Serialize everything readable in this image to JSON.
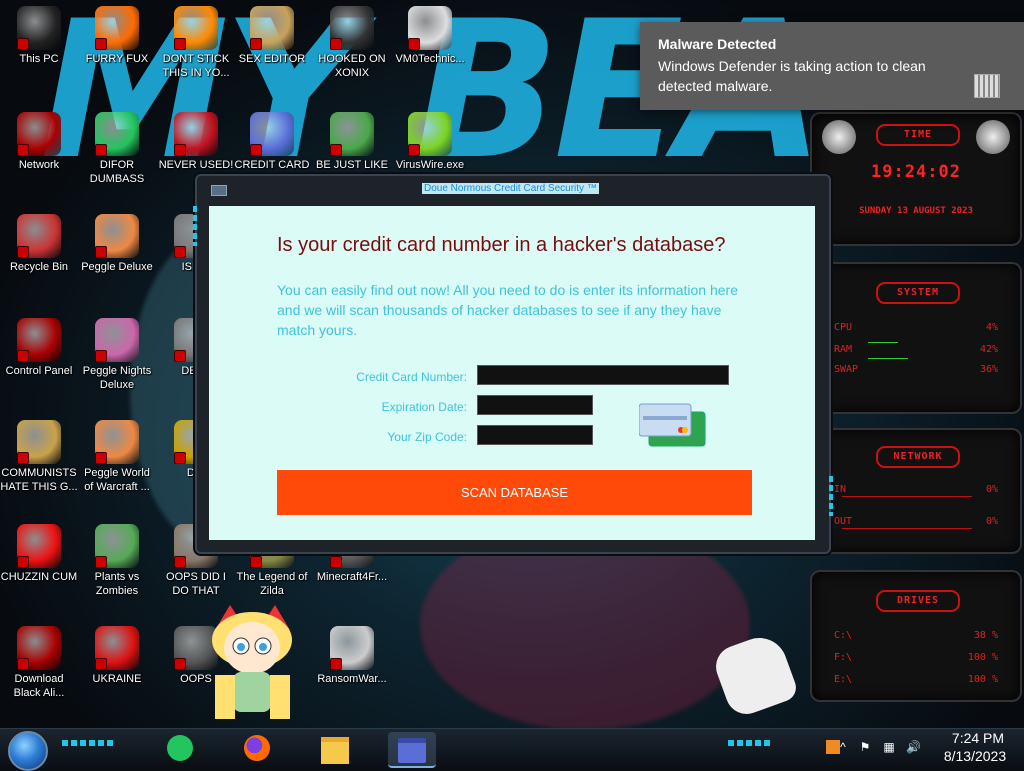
{
  "desktop": {
    "icons": [
      {
        "label": "This PC",
        "icon": "monitor-icon",
        "color": "#222"
      },
      {
        "label": "FURRY FUX",
        "icon": "firefox-icon",
        "color": "#ff6a00"
      },
      {
        "label": "DONT STICK THIS IN YO...",
        "icon": "traffic-cone-icon",
        "color": "#ff8800"
      },
      {
        "label": "SEX EDITOR",
        "icon": "image-editor-icon",
        "color": "#c9a25a"
      },
      {
        "label": "HOOKED ON XONIX",
        "icon": "game-icon",
        "color": "#333"
      },
      {
        "label": "VM0Technic...",
        "icon": "doctor-icon",
        "color": "#ddd"
      },
      {
        "label": "Network",
        "icon": "alien-network-icon",
        "color": "#a00"
      },
      {
        "label": "DIFOR DUMBASS",
        "icon": "chat-icon",
        "color": "#22c55e"
      },
      {
        "label": "NEVER USED!",
        "icon": "dev-icon",
        "color": "#c1121f"
      },
      {
        "label": "CREDIT CARD",
        "icon": "credit-card-icon",
        "color": "#5b6ed8"
      },
      {
        "label": "BE JUST LIKE",
        "icon": "santa-icon",
        "color": "#4aa84a"
      },
      {
        "label": "VirusWire.exe",
        "icon": "lime-icon",
        "color": "#7cd320"
      },
      {
        "label": "Recycle Bin",
        "icon": "recycle-bin-icon",
        "color": "#c33"
      },
      {
        "label": "Peggle Deluxe",
        "icon": "peggle-icon",
        "color": "#e84"
      },
      {
        "label": "ISRAI",
        "icon": "app-icon",
        "color": "#777"
      },
      {
        "label": "Control Panel",
        "icon": "control-panel-icon",
        "color": "#a00"
      },
      {
        "label": "Peggle Nights Deluxe",
        "icon": "peggle-icon",
        "color": "#c6a"
      },
      {
        "label": "DEEZ",
        "icon": "app-icon",
        "color": "#777"
      },
      {
        "label": "COMMUNISTS HATE THIS G...",
        "icon": "money-bag-icon",
        "color": "#c9a24a"
      },
      {
        "label": "Peggle World of Warcraft ...",
        "icon": "peggle-icon",
        "color": "#e84"
      },
      {
        "label": "DIE",
        "icon": "app-icon",
        "color": "#c9a200"
      },
      {
        "label": "CHUZZIN CUM",
        "icon": "chuzzle-icon",
        "color": "#e11"
      },
      {
        "label": "Plants vs Zombies",
        "icon": "plant-icon",
        "color": "#5a5"
      },
      {
        "label": "OOPS DID I DO THAT",
        "icon": "photo-icon",
        "color": "#876"
      },
      {
        "label": "The Legend of Zilda",
        "icon": "game-icon",
        "color": "#884"
      },
      {
        "label": "Minecraft4Fr...",
        "icon": "game-icon",
        "color": "#555"
      },
      {
        "label": "Download Black Ali...",
        "icon": "alien-icon",
        "color": "#a00"
      },
      {
        "label": "UKRAINE",
        "icon": "radiation-icon",
        "color": "#d11"
      },
      {
        "label": "OOPS",
        "icon": "app-icon",
        "color": "#555"
      },
      {
        "label": "RansomWar...",
        "icon": "skull-icon",
        "color": "#ccc"
      }
    ]
  },
  "toast": {
    "title": "Malware Detected",
    "body": "Windows Defender is taking action to clean detected malware."
  },
  "window": {
    "title": "Doue Normous Credit Card Security ™",
    "heading": "Is your credit card number in a hacker's database?",
    "description": "You can easily find out now! All you need to do is enter its information here and we will scan thousands of hacker databases to see if any they have match yours.",
    "fields": {
      "card_number_label": "Credit Card Number:",
      "card_number_value": "",
      "expiration_label": "Expiration Date:",
      "expiration_value": "",
      "zip_label": "Your Zip Code:",
      "zip_value": ""
    },
    "scan_button": "SCAN DATABASE",
    "accent_color": "#ff4a0a",
    "heading_color": "#7a0c0c"
  },
  "gadgets": {
    "time": {
      "title": "TIME",
      "clock": "19:24:02",
      "date": "SUNDAY 13 AUGUST 2023"
    },
    "system": {
      "title": "SYSTEM",
      "rows": [
        {
          "label": "CPU",
          "value": "4%"
        },
        {
          "label": "RAM",
          "value": "42%"
        },
        {
          "label": "SWAP",
          "value": "36%"
        }
      ]
    },
    "network": {
      "title": "NETWORK",
      "rows": [
        {
          "label": "IN",
          "value": "0%"
        },
        {
          "label": "OUT",
          "value": "0%"
        }
      ]
    },
    "drives": {
      "title": "DRIVES",
      "rows": [
        {
          "label": "C:\\",
          "value": "38 %"
        },
        {
          "label": "F:\\",
          "value": "100 %"
        },
        {
          "label": "E:\\",
          "value": "100 %"
        }
      ]
    }
  },
  "taskbar": {
    "time": "7:24 PM",
    "date": "8/13/2023",
    "pinned": [
      {
        "icon": "chat-icon",
        "active": false
      },
      {
        "icon": "firefox-icon",
        "active": false
      },
      {
        "icon": "file-explorer-icon",
        "active": false
      },
      {
        "icon": "credit-card-icon",
        "active": true
      }
    ]
  }
}
